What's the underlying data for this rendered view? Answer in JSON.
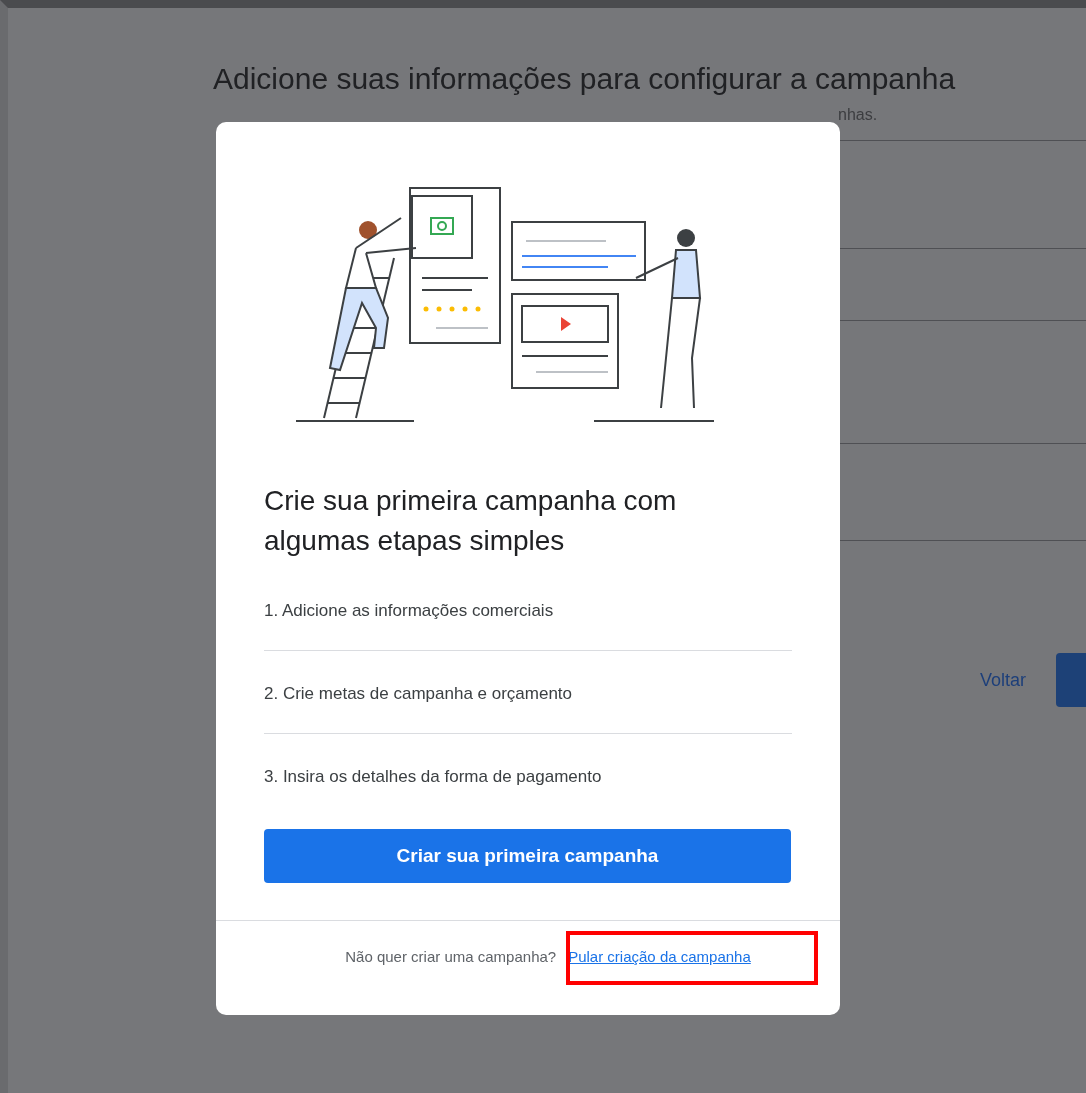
{
  "background": {
    "title": "Adicione suas informações para configurar a campanha",
    "subtitle_visible": "nhas.",
    "back_link": "Voltar"
  },
  "dialog": {
    "heading": "Crie sua primeira campanha com algumas etapas simples",
    "steps": [
      "1. Adicione as informações comerciais",
      "2. Crie metas de campanha e orçamento",
      "3. Insira os detalhes da forma de pagamento"
    ],
    "primary_button": "Criar sua primeira campanha",
    "footer_text": "Não quer criar uma campanha?",
    "footer_link": {
      "label": "Pular criação da campanha",
      "highlighted": true
    }
  }
}
